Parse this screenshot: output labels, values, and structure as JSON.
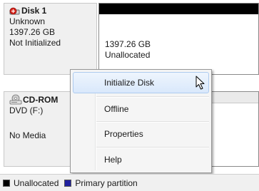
{
  "disk1": {
    "name": "Disk 1",
    "type": "Unknown",
    "size": "1397.26 GB",
    "status": "Not Initialized",
    "volume": {
      "size": "1397.26 GB",
      "status": "Unallocated"
    }
  },
  "cdrom": {
    "name": "CD-ROM",
    "drive": "DVD (F:)",
    "status": "No Media"
  },
  "context_menu": {
    "items": [
      "Initialize Disk",
      "Offline",
      "Properties",
      "Help"
    ],
    "highlighted": "Initialize Disk"
  },
  "legend": {
    "items": [
      {
        "label": "Unallocated",
        "color": "#000000"
      },
      {
        "label": "Primary partition",
        "color": "#1f1f9e"
      }
    ]
  },
  "icons": {
    "disk": "disk-warning-icon",
    "cdrom": "cd-rom-icon",
    "cursor": "mouse-pointer-icon"
  }
}
